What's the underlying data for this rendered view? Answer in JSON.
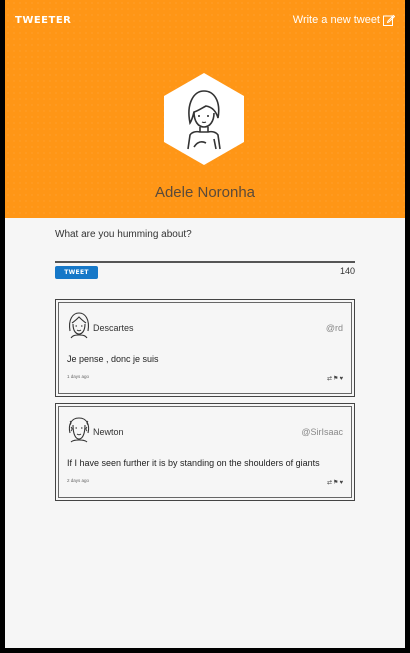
{
  "header": {
    "logo": "TWEETER",
    "new_tweet_label": "Write a new tweet",
    "edit_icon": "edit-icon",
    "username": "Adele Noronha",
    "bg_color": "#ff9616"
  },
  "composer": {
    "prompt": "What are you humming about?",
    "button_label": "TWEET",
    "remaining_chars": "140",
    "button_color": "#1678c8"
  },
  "tweets": [
    {
      "author": "Descartes",
      "handle": "@rd",
      "text": "Je pense , donc je suis",
      "time": "1 days ago",
      "icons": [
        "retweet-icon",
        "flag-icon",
        "heart-icon"
      ]
    },
    {
      "author": "Newton",
      "handle": "@SirIsaac",
      "text": "If I have seen further it is by standing on the shoulders of giants",
      "time": "2 days ago",
      "icons": [
        "retweet-icon",
        "flag-icon",
        "heart-icon"
      ]
    }
  ]
}
